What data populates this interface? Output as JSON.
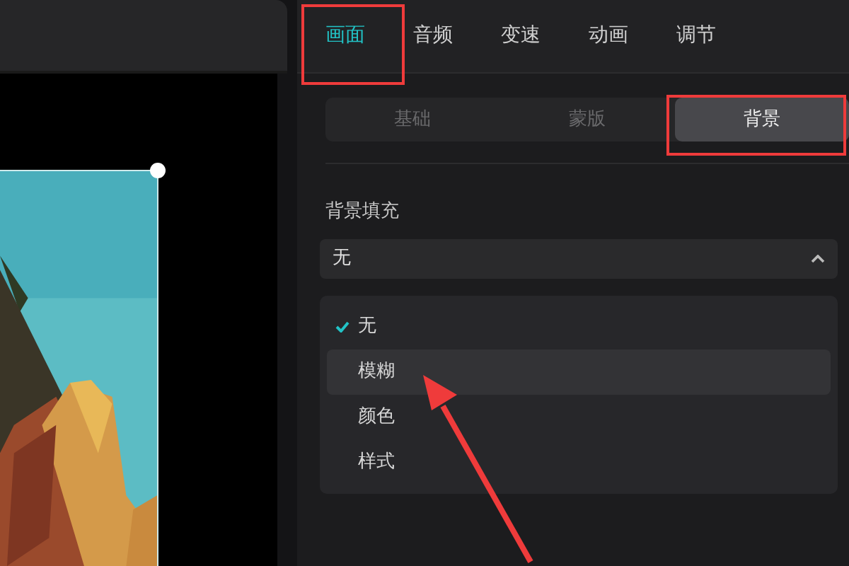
{
  "tabs": [
    {
      "label": "画面",
      "selected": true,
      "annotated": true
    },
    {
      "label": "音频",
      "selected": false,
      "annotated": false
    },
    {
      "label": "变速",
      "selected": false,
      "annotated": false
    },
    {
      "label": "动画",
      "selected": false,
      "annotated": false
    },
    {
      "label": "调节",
      "selected": false,
      "annotated": false
    }
  ],
  "segments": [
    {
      "label": "基础",
      "selected": false,
      "annotated": false
    },
    {
      "label": "蒙版",
      "selected": false,
      "annotated": false
    },
    {
      "label": "背景",
      "selected": true,
      "annotated": true
    }
  ],
  "background_fill": {
    "label": "背景填充",
    "value": "无",
    "expanded": true,
    "options": [
      {
        "label": "无",
        "checked": true,
        "highlighted": false,
        "pointed": false
      },
      {
        "label": "模糊",
        "checked": false,
        "highlighted": true,
        "pointed": true
      },
      {
        "label": "颜色",
        "checked": false,
        "highlighted": false,
        "pointed": false
      },
      {
        "label": "样式",
        "checked": false,
        "highlighted": false,
        "pointed": false
      }
    ]
  },
  "preview": {
    "selected": true
  }
}
